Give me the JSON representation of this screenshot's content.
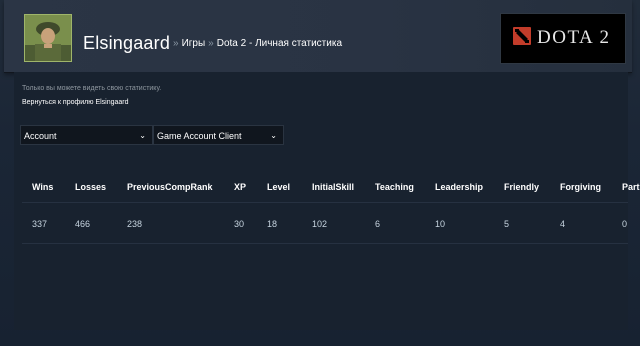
{
  "header": {
    "profile_name": "Elsingaard",
    "breadcrumb": {
      "separator": "»",
      "games_link": "Игры",
      "page_title": "Dota 2 - Личная статистика"
    },
    "game_logo_text": "DOTA 2"
  },
  "content": {
    "notice": "Только вы можете видеть свою статистику.",
    "back_link": "Вернуться к профилю Elsingaard"
  },
  "filters": {
    "account_select": "Account",
    "client_select": "Game Account Client"
  },
  "table": {
    "columns": [
      "Wins",
      "Losses",
      "PreviousCompRank",
      "XP",
      "Level",
      "InitialSkill",
      "Teaching",
      "Leadership",
      "Friendly",
      "Forgiving",
      "Part"
    ],
    "rows": [
      [
        "337",
        "466",
        "238",
        "30",
        "18",
        "102",
        "6",
        "10",
        "5",
        "4",
        "0"
      ]
    ]
  },
  "colors": {
    "background": "#1b2838",
    "header": "#2b3545",
    "text": "#c7d5e0",
    "link": "#ffffff",
    "dota_red": "#c23c2a"
  }
}
